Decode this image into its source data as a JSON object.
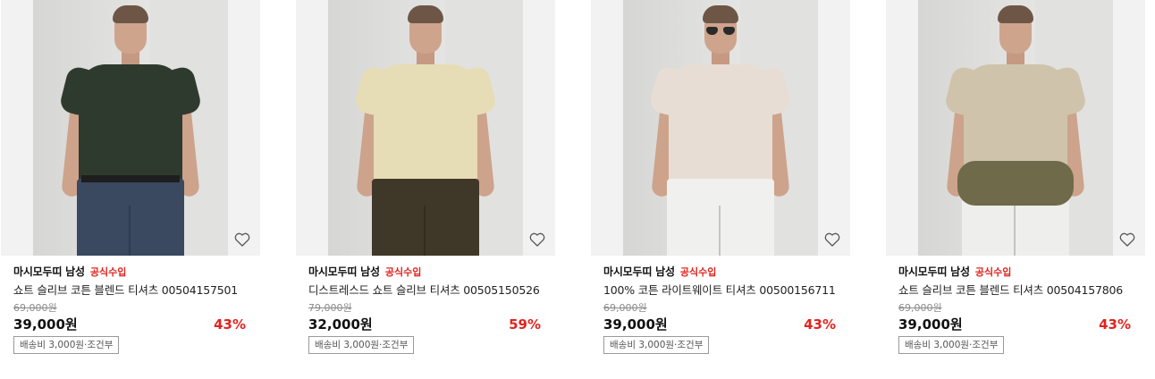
{
  "products": [
    {
      "brand": "마시모두띠 남성",
      "badge": "공식수입",
      "title": "쇼트 슬리브 코튼 블렌드 티셔츠 00504157501",
      "original_price": "69,000원",
      "price": "39,000원",
      "discount": "43%",
      "shipping": "배송비 3,000원·조건부",
      "colors": {
        "shirt": "#2f3a2f",
        "pants": "#3a4860"
      }
    },
    {
      "brand": "마시모두띠 남성",
      "badge": "공식수입",
      "title": "디스트레스드 쇼트 슬리브 티셔츠 00505150526",
      "original_price": "79,000원",
      "price": "32,000원",
      "discount": "59%",
      "shipping": "배송비 3,000원·조건부",
      "colors": {
        "shirt": "#e6dcb6",
        "pants": "#3f3727"
      }
    },
    {
      "brand": "마시모두띠 남성",
      "badge": "공식수입",
      "title": "100% 코튼 라이트웨이트 티셔츠 00500156711",
      "original_price": "69,000원",
      "price": "39,000원",
      "discount": "43%",
      "shipping": "배송비 3,000원·조건부",
      "colors": {
        "shirt": "#e8ddd4",
        "pants": "#f0f0ee"
      }
    },
    {
      "brand": "마시모두띠 남성",
      "badge": "공식수입",
      "title": "쇼트 슬리브 코튼 블렌드 티셔츠 00504157806",
      "original_price": "69,000원",
      "price": "39,000원",
      "discount": "43%",
      "shipping": "배송비 3,000원·조건부",
      "colors": {
        "shirt": "#cfc4ab",
        "pants": "#eeeeec"
      }
    }
  ],
  "icons": {
    "wishlist": "heart-outline-icon"
  },
  "accent_color": "#e1231e"
}
